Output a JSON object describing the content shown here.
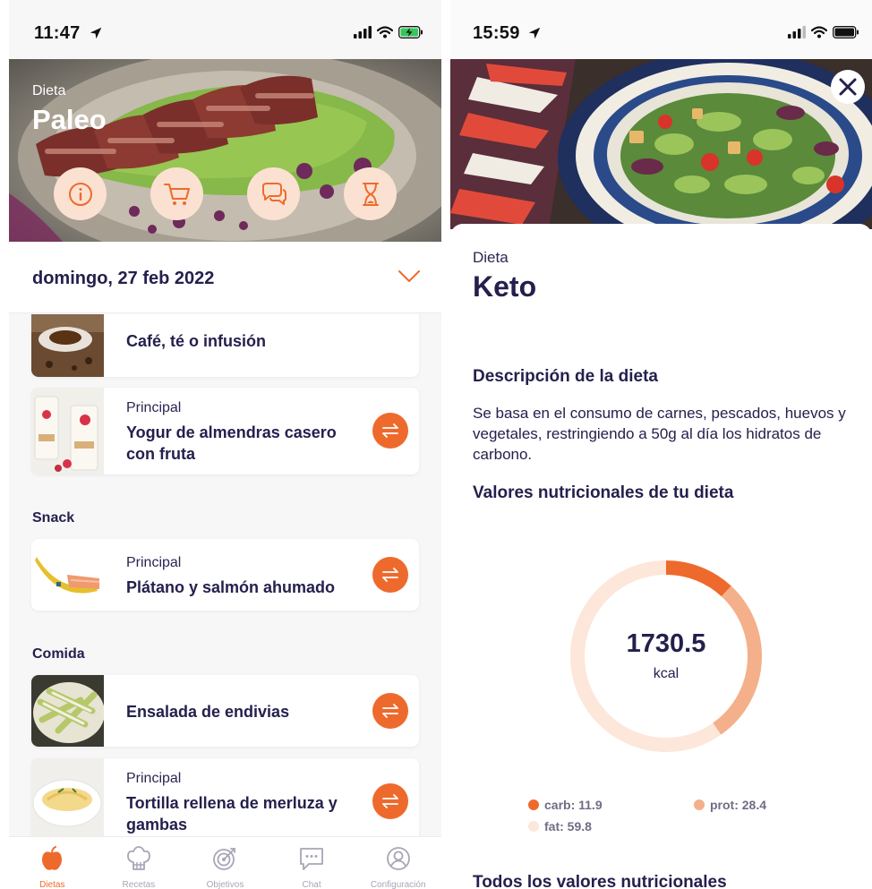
{
  "left": {
    "status": {
      "time": "11:47"
    },
    "hero": {
      "diet_label": "Dieta",
      "diet_name": "Paleo"
    },
    "actions": [
      {
        "icon": "info-icon"
      },
      {
        "icon": "cart-icon"
      },
      {
        "icon": "chat-icon"
      },
      {
        "icon": "hourglass-icon"
      }
    ],
    "date": "domingo, 27 feb 2022",
    "meals": [
      {
        "category": "",
        "title": "Café, té o infusión"
      },
      {
        "category": "Principal",
        "title": "Yogur de almendras casero con fruta"
      },
      {
        "category": "Principal",
        "title": "Plátano y salmón ahumado"
      },
      {
        "category": "",
        "title": "Ensalada de endivias"
      },
      {
        "category": "Principal",
        "title": "Tortilla rellena de merluza y gambas"
      }
    ],
    "sections": {
      "snack": "Snack",
      "comida": "Comida"
    },
    "tabs": [
      {
        "label": "Dietas",
        "icon": "apple-icon",
        "active": true
      },
      {
        "label": "Recetas",
        "icon": "chef-hat-icon",
        "active": false
      },
      {
        "label": "Objetivos",
        "icon": "target-icon",
        "active": false
      },
      {
        "label": "Chat",
        "icon": "chat-icon",
        "active": false
      },
      {
        "label": "Configuración",
        "icon": "user-icon",
        "active": false
      }
    ]
  },
  "right": {
    "status": {
      "time": "15:59"
    },
    "diet_label": "Dieta",
    "diet_name": "Keto",
    "description_heading": "Descripción de la dieta",
    "description": "Se basa en el consumo de carnes, pescados, huevos y vegetales, restringiendo a 50g al día los hidratos de carbono.",
    "nutrition_heading": "Valores nutricionales de tu dieta",
    "kcal_value": "1730.5",
    "kcal_unit": "kcal",
    "macros": [
      {
        "label": "carb: 11.9",
        "value": 11.9,
        "color": "#ee6a2c"
      },
      {
        "label": "prot: 28.4",
        "value": 28.4,
        "color": "#f4b08a"
      },
      {
        "label": "fat: 59.8",
        "value": 59.8,
        "color": "#fde6da"
      }
    ],
    "all_values_heading": "Todos los valores nutricionales"
  },
  "colors": {
    "accent": "#ee6a2c",
    "navy": "#24204d"
  }
}
